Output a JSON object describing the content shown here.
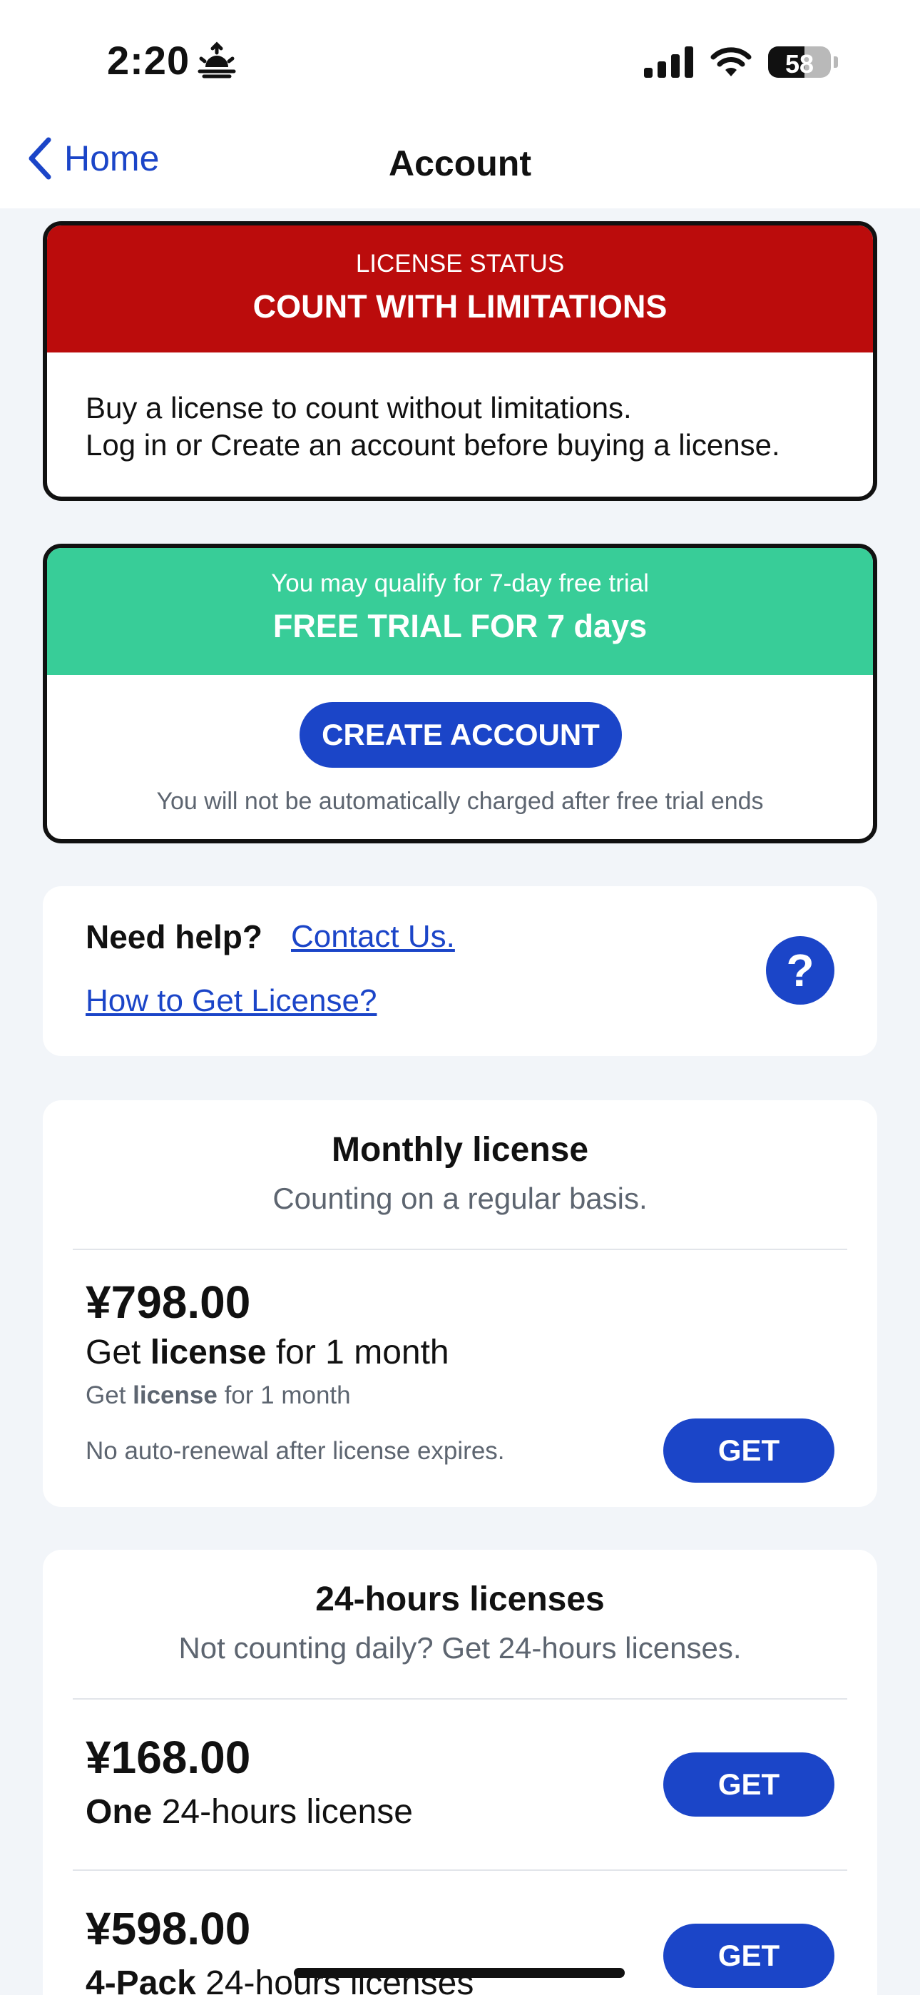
{
  "status_bar": {
    "time": "2:20",
    "battery": "58"
  },
  "nav": {
    "back_label": "Home",
    "title": "Account"
  },
  "license_status": {
    "subtitle": "LICENSE STATUS",
    "title": "COUNT WITH LIMITATIONS",
    "line1": "Buy a license to count without limitations.",
    "line2": "Log in or Create an account before buying a license.",
    "color": "#bb0c0c"
  },
  "trial": {
    "subtitle": "You may qualify for 7-day free trial",
    "title": "FREE TRIAL FOR 7 days",
    "button": "CREATE ACCOUNT",
    "note": "You will not be automatically charged after free trial ends",
    "color": "#38cd98"
  },
  "help": {
    "question": "Need help?",
    "contact": "Contact Us.",
    "howto": "How to Get License?",
    "icon": "?"
  },
  "monthly": {
    "title": "Monthly license",
    "subtitle": "Counting on a regular basis.",
    "price": "¥798.00",
    "desc_prefix": "Get ",
    "desc_bold": "license",
    "desc_suffix": " for 1 month",
    "small_prefix": "Get ",
    "small_bold": "license",
    "small_suffix": " for 1 month",
    "renewal_note": "No auto-renewal after license expires.",
    "button": "GET"
  },
  "hours": {
    "title": "24-hours licenses",
    "subtitle": "Not counting daily? Get 24-hours licenses.",
    "items": [
      {
        "price": "¥168.00",
        "bold": "One",
        "rest": " 24-hours license",
        "button": "GET"
      },
      {
        "price": "¥598.00",
        "bold": "4-Pack",
        "rest": " 24-hours licenses",
        "button": "GET"
      }
    ]
  },
  "colors": {
    "accent": "#1b45c8"
  }
}
